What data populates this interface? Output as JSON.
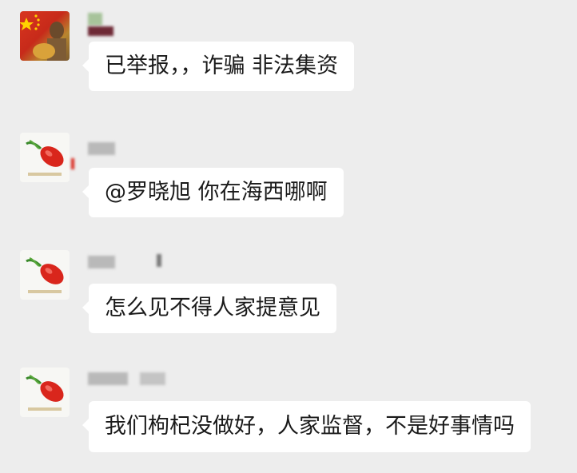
{
  "chat": {
    "messages": [
      {
        "avatar": "flag-avatar",
        "text": "已举报，，诈骗   非法集资"
      },
      {
        "avatar": "goji-logo-avatar",
        "text": "@罗晓旭 你在海西哪啊"
      },
      {
        "avatar": "goji-logo-avatar",
        "text": "怎么见不得人家提意见"
      },
      {
        "avatar": "goji-logo-avatar",
        "text": "我们枸杞没做好，人家监督，不是好事情吗"
      }
    ]
  },
  "colors": {
    "background": "#ededed",
    "bubble": "#ffffff",
    "text": "#1a1a1a",
    "avatar_red": "#d8361f"
  }
}
